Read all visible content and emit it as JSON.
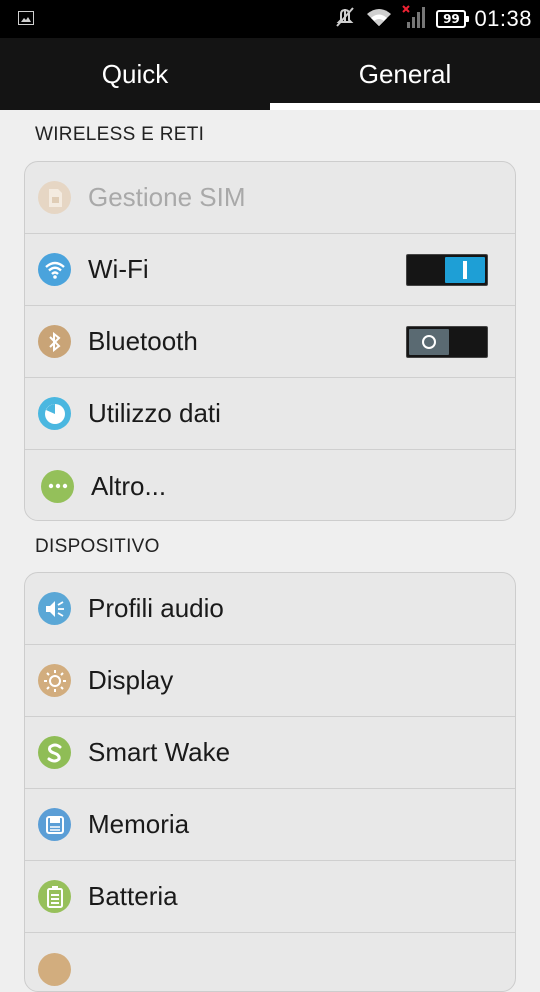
{
  "status_bar": {
    "battery": "99",
    "time": "01:38",
    "icons": [
      "image-notification-icon",
      "mute-icon",
      "wifi-signal-icon",
      "no-signal-icon",
      "battery-icon"
    ]
  },
  "tabs": [
    {
      "label": "Quick",
      "active": false
    },
    {
      "label": "General",
      "active": true
    }
  ],
  "sections": [
    {
      "header": "WIRELESS E RETI",
      "items": [
        {
          "label": "Gestione SIM",
          "icon": "sim-card-icon",
          "disabled": true
        },
        {
          "label": "Wi-Fi",
          "icon": "wifi-icon",
          "toggle": "on"
        },
        {
          "label": "Bluetooth",
          "icon": "bluetooth-icon",
          "toggle": "off"
        },
        {
          "label": "Utilizzo dati",
          "icon": "data-usage-icon"
        },
        {
          "label": "Altro...",
          "icon": "more-icon"
        }
      ]
    },
    {
      "header": "DISPOSITIVO",
      "items": [
        {
          "label": "Profili audio",
          "icon": "speaker-icon"
        },
        {
          "label": "Display",
          "icon": "brightness-icon"
        },
        {
          "label": "Smart Wake",
          "icon": "smart-wake-icon"
        },
        {
          "label": "Memoria",
          "icon": "storage-icon"
        },
        {
          "label": "Batteria",
          "icon": "battery-settings-icon"
        }
      ]
    }
  ],
  "colors": {
    "accent": "#1e9fd6",
    "background": "#efefef",
    "card": "#e8e8e8"
  }
}
